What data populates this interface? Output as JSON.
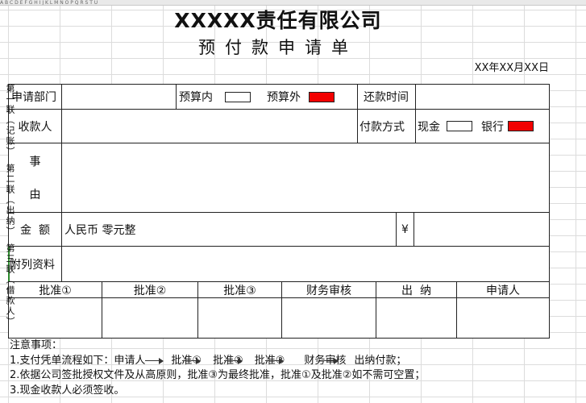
{
  "column_header": "A  B  C  D  E  F  G  H  I  J  K  L  M  N  O  P  Q  R  S  T  U",
  "company": "XXXXX责任有限公司",
  "form_title": "预付款申请单",
  "date": "XX年XX月XX日",
  "row1": {
    "dept_label": "申请部门",
    "budget_in_label": "预算内",
    "budget_out_label": "预算外",
    "repay_label": "还款时间"
  },
  "row2": {
    "payee_label": "收款人",
    "pay_method_label": "付款方式",
    "cash_label": "现金",
    "bank_label": "银行"
  },
  "row3": {
    "matter_label_1": "事",
    "matter_label_2": "由"
  },
  "row4": {
    "amount_label": "金  额",
    "amount_words": "人民币 零元整",
    "yen": "¥"
  },
  "row5": {
    "attach_label": "附列资料"
  },
  "approvals": [
    "批准①",
    "批准②",
    "批准③",
    "财务审核",
    "出  纳",
    "申请人"
  ],
  "notes": {
    "title": "注意事项：",
    "line1_prefix": "1.支付凭单流程如下：",
    "line1_flow": [
      "申请人",
      "批准①",
      "批准②",
      "批准③",
      "财务审核",
      "出纳付款；"
    ],
    "line2": "2.依据公司签批授权文件及从高原则，批准③为最终批准，批准①及批准②如不需可空置；",
    "line3": "3.现金收款人必须签收。"
  },
  "copies": [
    "第一联（记账）",
    "第二联（出纳）",
    "第三联（借款人）"
  ],
  "colors": {
    "checked_box": "#f20000",
    "grid": "#dcdcdc"
  }
}
